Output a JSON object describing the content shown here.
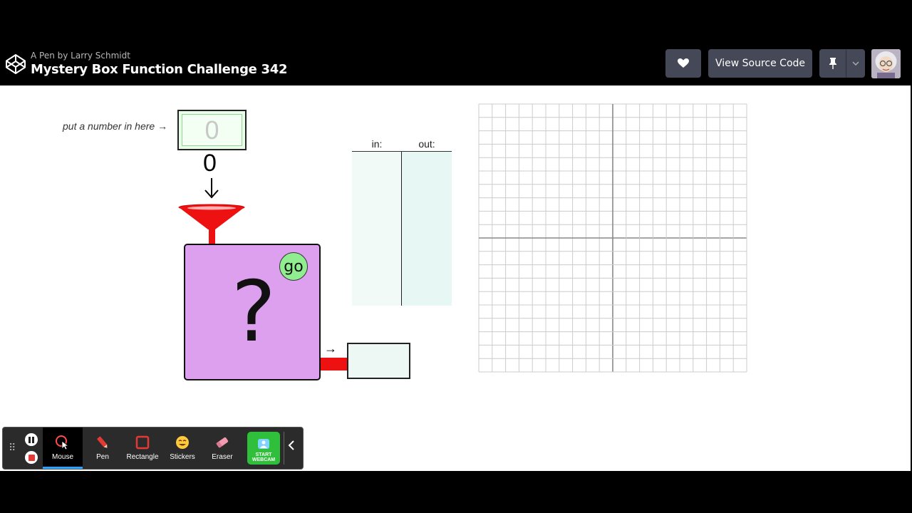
{
  "header": {
    "byline": "A Pen by Larry Schmidt",
    "title": "Mystery Box Function Challenge 342",
    "view_source_label": "View Source Code"
  },
  "machine": {
    "prompt": "put a number in here →",
    "input_value": "0",
    "dropped_number": "0",
    "mystery_symbol": "?",
    "go_label": "go",
    "output_arrow": "→",
    "output_value": ""
  },
  "table": {
    "in_header": "in:",
    "out_header": "out:",
    "rows": []
  },
  "graph": {
    "grid": true,
    "cells": 20,
    "points": []
  },
  "toolbar": {
    "tools": [
      {
        "label": "Mouse",
        "icon": "mouse-cursor-icon",
        "active": true
      },
      {
        "label": "Pen",
        "icon": "pen-icon",
        "active": false
      },
      {
        "label": "Rectangle",
        "icon": "rectangle-icon",
        "active": false
      },
      {
        "label": "Stickers",
        "icon": "sticker-icon",
        "active": false
      },
      {
        "label": "Eraser",
        "icon": "eraser-icon",
        "active": false
      }
    ],
    "webcam_label": "START WEBCAM"
  },
  "colors": {
    "box_fill": "#dda0ee",
    "funnel": "#ee1111",
    "go_button": "#90ee90",
    "header_button": "#444857",
    "webcam_button": "#2fbf3a"
  }
}
